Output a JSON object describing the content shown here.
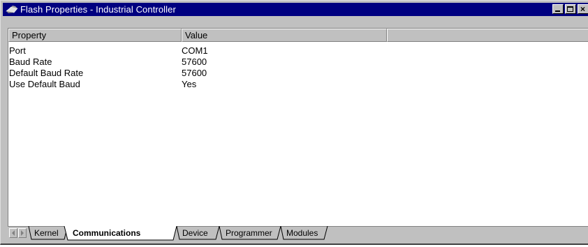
{
  "window": {
    "title": "Flash Properties - Industrial Controller",
    "icon": "flash-device-icon",
    "controls": [
      "minimize-icon",
      "maximize-icon",
      "close-icon"
    ]
  },
  "list": {
    "columns": [
      "Property",
      "Value",
      ""
    ],
    "rows": [
      {
        "property": "Port",
        "value": "COM1"
      },
      {
        "property": "Baud Rate",
        "value": "57600"
      },
      {
        "property": "Default Baud Rate",
        "value": "57600"
      },
      {
        "property": "Use Default Baud",
        "value": "Yes"
      }
    ]
  },
  "tabs": {
    "items": [
      "Kernel",
      "Communications",
      "Device",
      "Programmer",
      "Modules"
    ],
    "selected": "Communications",
    "scroll_icons": [
      "scroll-left-icon",
      "scroll-right-icon"
    ]
  }
}
